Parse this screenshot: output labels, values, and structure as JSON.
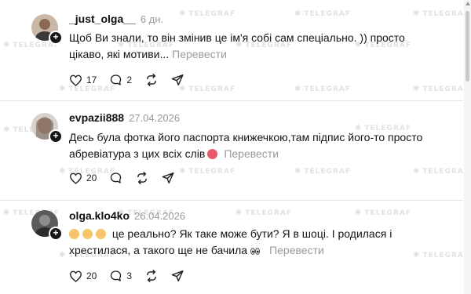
{
  "watermark": "TELEGRAF",
  "comments": [
    {
      "username": "_just_olga__",
      "time": "6 дн.",
      "text": "Щоб Ви знали, то він змінив це ім'я собі сам спеціально. )) просто цікаво, які мотиви...",
      "translate": "Перевести",
      "likes": "17",
      "replies": "2",
      "avatar_icon": "avatar-photo"
    },
    {
      "username": "evpazii888",
      "time": "27.04.2026",
      "text": "Десь була фотка його паспорта книжечкою,там підпис його-то просто абревіатура з цих всіх слів",
      "translate": "Перевести",
      "likes": "20",
      "replies": "",
      "avatar_icon": "avatar-photo"
    },
    {
      "username": "olga.klo4ko",
      "time": "26.04.2026",
      "text": "це реально? Як таке може бути? Я в шоці. І родилася і хрестилася, а такого ще не бачила",
      "translate": "Перевести",
      "likes": "20",
      "replies": "3",
      "avatar_icon": "avatar-photo"
    }
  ],
  "colors": {
    "muted": "#9a9a9a",
    "emoji": "#f6c46a"
  }
}
